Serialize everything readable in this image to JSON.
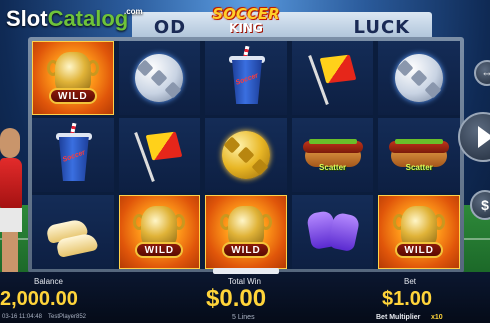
{
  "watermark": {
    "part1": "Slot",
    "part2": "Catalog",
    "suffix": ".com"
  },
  "logo": {
    "top": "SOCCER",
    "bottom": "KING"
  },
  "sign": {
    "left": "OD",
    "right": "LUCK"
  },
  "reels": [
    [
      "wild",
      "ball-white",
      "cup",
      "flag",
      "ball-white"
    ],
    [
      "cup",
      "flag",
      "ball-gold",
      "hotdog",
      "hotdog"
    ],
    [
      "boots",
      "wild",
      "wild",
      "gloves",
      "wild"
    ]
  ],
  "symbols": {
    "wild_label": "WILD",
    "scatter_label": "Scatter",
    "cup_text": "Soccer"
  },
  "balance": {
    "label": "Balance",
    "value": "2,000.00"
  },
  "total_win": {
    "label": "Total Win",
    "value": "$0.00"
  },
  "bet": {
    "label": "Bet",
    "value": "$1.00"
  },
  "footer": {
    "timestamp": "03-16 11:04:48",
    "player": "TestPlayer852",
    "lines": "5 Lines",
    "multiplier_label": "Bet Multiplier",
    "multiplier_value": "x10"
  },
  "colors": {
    "accent": "#ffd43a",
    "wild_bg": "#ff9a1a"
  },
  "icons": {
    "spin": "play-triangle-icon",
    "coin": "dollar-coin-icon",
    "arrows": "expand-arrows-icon"
  }
}
